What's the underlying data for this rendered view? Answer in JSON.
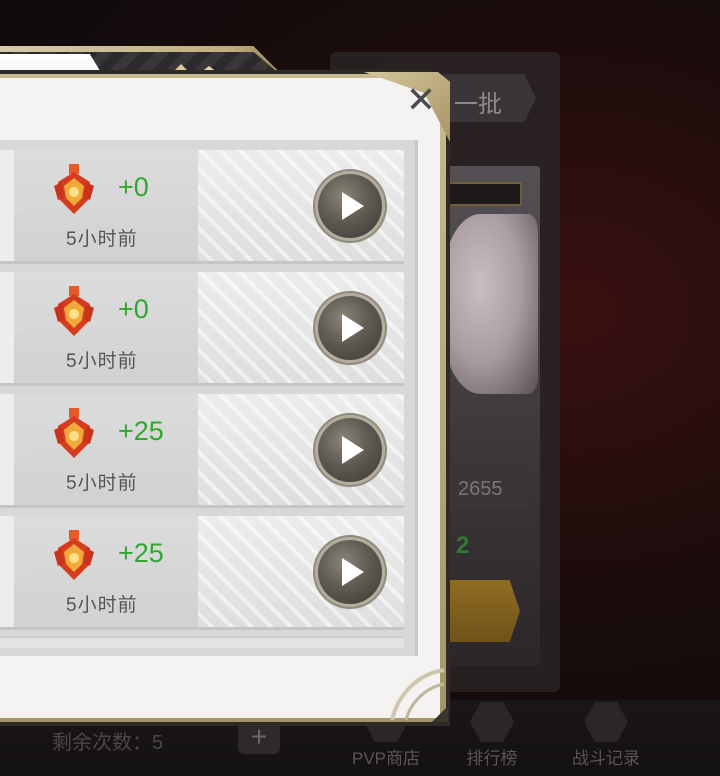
{
  "background": {
    "refresh_label": "一批",
    "score_value": "2655",
    "green_value": "2"
  },
  "bottom_bar": {
    "remaining_label": "剩余次数：5",
    "nav": [
      {
        "label": "PVP商店",
        "icon": "shop-icon"
      },
      {
        "label": "排行榜",
        "icon": "medal-icon"
      },
      {
        "label": "战斗记录",
        "icon": "book-icon"
      }
    ]
  },
  "dialog": {
    "close_symbol": "✕",
    "records": [
      {
        "score_change": "+0",
        "time": "5小时前",
        "rank_icon": "rank-badge-icon"
      },
      {
        "score_change": "+0",
        "time": "5小时前",
        "rank_icon": "rank-badge-icon"
      },
      {
        "score_change": "+25",
        "time": "5小时前",
        "rank_icon": "rank-badge-icon"
      },
      {
        "score_change": "+25",
        "time": "5小时前",
        "rank_icon": "rank-badge-icon"
      }
    ]
  },
  "colors": {
    "score_positive": "#2fa82f",
    "frame_gold": "#bfae7e",
    "panel_bg": "#f5f3f1"
  }
}
